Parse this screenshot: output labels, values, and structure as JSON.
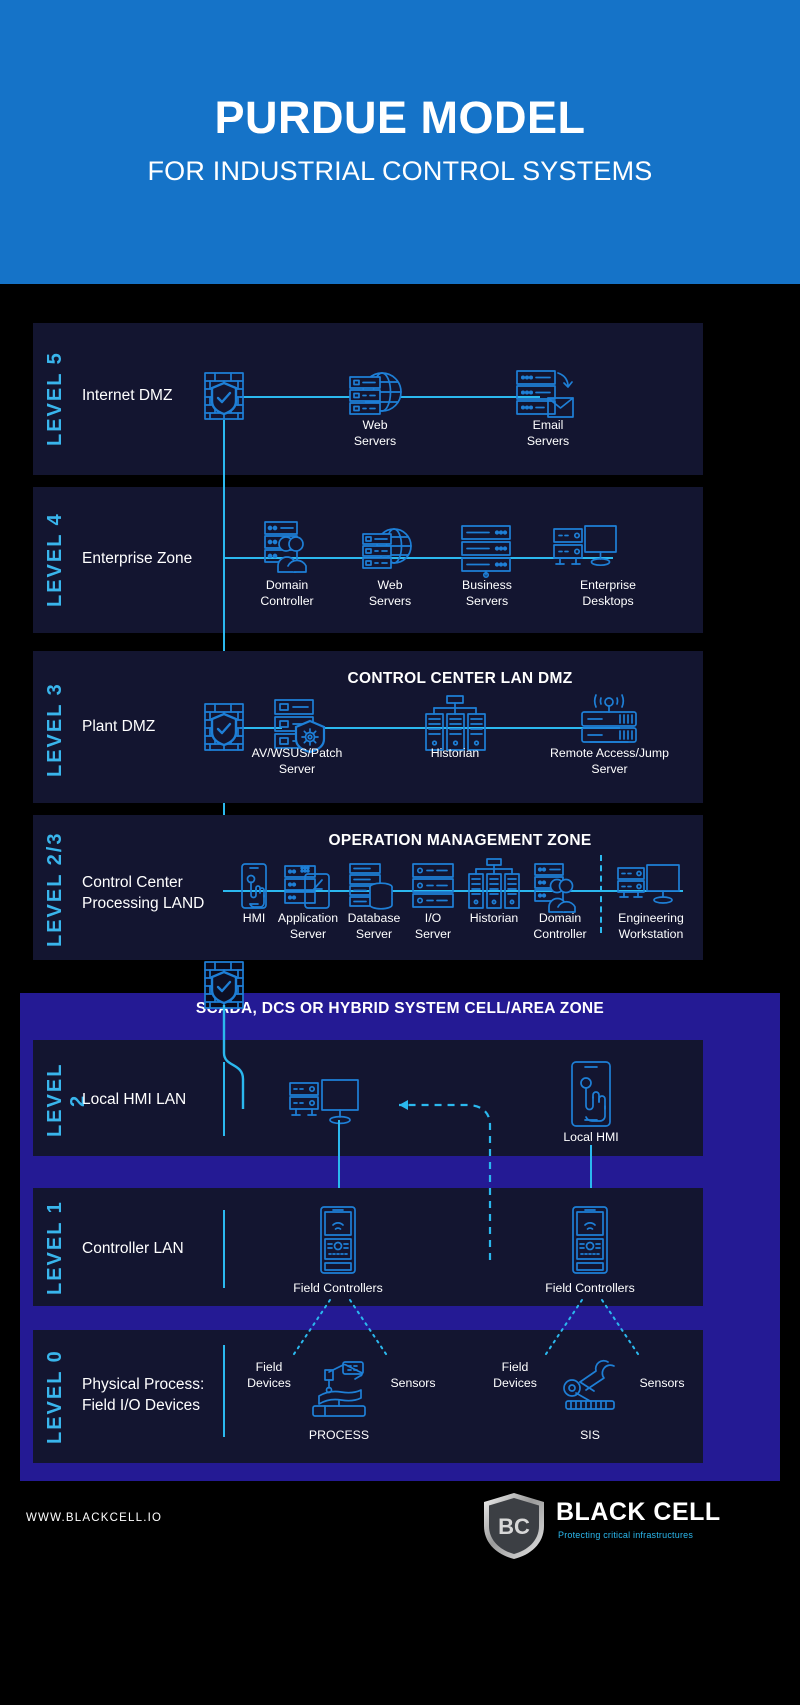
{
  "header": {
    "title": "PURDUE MODEL",
    "subtitle": "FOR INDUSTRIAL CONTROL SYSTEMS",
    "bg_color": "#1573c8"
  },
  "colors": {
    "accent": "#2bb8ee",
    "level_tag": "#39b5ec",
    "band_bg": "#131530",
    "scada_bg": "#241a94",
    "page_bg": "#000000",
    "icon_stroke": "#1e7fd6"
  },
  "levels": [
    {
      "tag": "LEVEL 5",
      "name": "Internet DMZ",
      "zone_title": "",
      "nodes": [
        {
          "label": "Web\nServers",
          "icon": "globe-server-icon"
        },
        {
          "label": "Email\nServers",
          "icon": "email-server-icon"
        }
      ]
    },
    {
      "tag": "LEVEL 4",
      "name": "Enterprise Zone",
      "zone_title": "",
      "nodes": [
        {
          "label": "Domain\nController",
          "icon": "domain-controller-icon"
        },
        {
          "label": "Web\nServers",
          "icon": "globe-server-icon"
        },
        {
          "label": "Business\nServers",
          "icon": "business-server-icon"
        },
        {
          "label": "Enterprise\nDesktops",
          "icon": "desktop-icon"
        }
      ]
    },
    {
      "tag": "LEVEL 3",
      "name": "Plant DMZ",
      "zone_title": "CONTROL CENTER LAN DMZ",
      "nodes": [
        {
          "label": "AV/WSUS/Patch\nServer",
          "icon": "patch-server-icon"
        },
        {
          "label": "Historian",
          "icon": "historian-icon"
        },
        {
          "label": "Remote Access/Jump\nServer",
          "icon": "remote-access-icon"
        }
      ]
    },
    {
      "tag": "LEVEL 2/3",
      "name": "Control Center\nProcessing LAND",
      "zone_title": "OPERATION MANAGEMENT ZONE",
      "nodes": [
        {
          "label": "HMI",
          "icon": "hmi-icon"
        },
        {
          "label": "Application\nServer",
          "icon": "application-server-icon"
        },
        {
          "label": "Database\nServer",
          "icon": "database-server-icon"
        },
        {
          "label": "I/O\nServer",
          "icon": "io-server-icon"
        },
        {
          "label": "Historian",
          "icon": "historian-icon"
        },
        {
          "label": "Domain\nController",
          "icon": "domain-controller-icon"
        },
        {
          "label": "Engineering\nWorkstation",
          "icon": "engineering-workstation-icon"
        }
      ]
    },
    {
      "tag": "LEVEL 2",
      "name": "Local HMI LAN",
      "zone_title": "",
      "nodes": [
        {
          "label": "",
          "icon": "server-monitor-icon"
        },
        {
          "label": "Local HMI",
          "icon": "hmi-icon"
        }
      ]
    },
    {
      "tag": "LEVEL 1",
      "name": "Controller LAN",
      "zone_title": "",
      "nodes": [
        {
          "label": "Field Controllers",
          "icon": "field-controller-icon"
        },
        {
          "label": "Field Controllers",
          "icon": "field-controller-icon"
        }
      ]
    },
    {
      "tag": "LEVEL 0",
      "name": "Physical Process:\nField I/O Devices",
      "zone_title": "",
      "nodes": [
        {
          "label": "PROCESS",
          "icon": "process-machine-icon"
        },
        {
          "label": "SIS",
          "icon": "robot-arm-icon"
        }
      ],
      "side_labels": [
        "Field\nDevices",
        "Sensors",
        "Field\nDevices",
        "Sensors"
      ]
    }
  ],
  "scada": {
    "title": "SCADA, DCS OR HYBRID SYSTEM CELL/AREA ZONE"
  },
  "l5": {
    "name": "Internet DMZ",
    "tag": "LEVEL 5",
    "web_l1": "Web",
    "web_l2": "Servers",
    "email_l1": "Email",
    "email_l2": "Servers"
  },
  "l4": {
    "name": "Enterprise Zone",
    "tag": "LEVEL 4",
    "n1a": "Domain",
    "n1b": "Controller",
    "n2a": "Web",
    "n2b": "Servers",
    "n3a": "Business",
    "n3b": "Servers",
    "n4a": "Enterprise",
    "n4b": "Desktops"
  },
  "l3": {
    "name": "Plant DMZ",
    "tag": "LEVEL 3",
    "zone": "CONTROL CENTER LAN DMZ",
    "n1a": "AV/WSUS/Patch",
    "n1b": "Server",
    "n2a": "Historian",
    "n3a": "Remote Access/Jump",
    "n3b": "Server"
  },
  "l23": {
    "name_a": "Control Center",
    "name_b": "Processing LAND",
    "tag": "LEVEL 2/3",
    "zone": "OPERATION MANAGEMENT ZONE",
    "n1": "HMI",
    "n2a": "Application",
    "n2b": "Server",
    "n3a": "Database",
    "n3b": "Server",
    "n4a": "I/O",
    "n4b": "Server",
    "n5": "Historian",
    "n6a": "Domain",
    "n6b": "Controller",
    "n7a": "Engineering",
    "n7b": "Workstation"
  },
  "l2": {
    "name": "Local HMI LAN",
    "tag": "LEVEL 2",
    "hmi_label": "Local HMI"
  },
  "l1": {
    "name": "Controller LAN",
    "tag": "LEVEL 1",
    "fc_left": "Field Controllers",
    "fc_right": "Field Controllers"
  },
  "l0": {
    "name_a": "Physical Process:",
    "name_b": "Field I/O Devices",
    "tag": "LEVEL 0",
    "fd_left_a": "Field",
    "fd_left_b": "Devices",
    "sensors_left": "Sensors",
    "process": "PROCESS",
    "fd_right_a": "Field",
    "fd_right_b": "Devices",
    "sensors_right": "Sensors",
    "sis": "SIS"
  },
  "footer": {
    "url": "WWW.BLACKCELL.IO",
    "brand": "BLACK CELL",
    "tagline": "Protecting critical infrastructures",
    "logo_mark": "BC"
  }
}
